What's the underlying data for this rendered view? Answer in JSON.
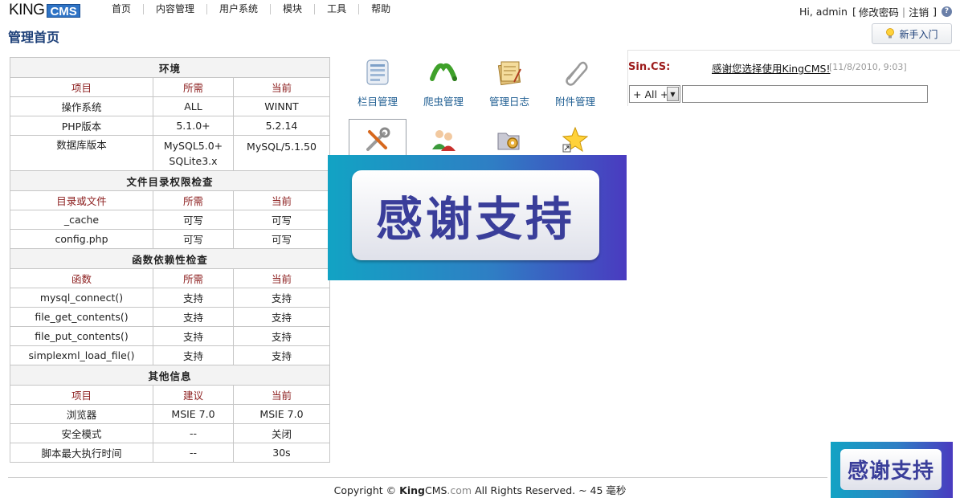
{
  "header": {
    "logo_king": "KING",
    "logo_cms": "CMS",
    "nav": [
      "首页",
      "内容管理",
      "用户系统",
      "模块",
      "工具",
      "帮助"
    ],
    "greeting": "Hi, admin",
    "bracket_open": "[",
    "change_password": "修改密码",
    "separator": "|",
    "logout": "注销",
    "bracket_close": "]"
  },
  "page_title": "管理首页",
  "guide_button": "新手入门",
  "env_table": {
    "sections": [
      {
        "title": "环境",
        "headers": [
          "项目",
          "所需",
          "当前"
        ],
        "rows": [
          [
            "操作系统",
            "ALL",
            "WINNT"
          ],
          [
            "PHP版本",
            "5.1.0+",
            "5.2.14"
          ],
          [
            "数据库版本",
            "MySQL5.0+ SQLite3.x",
            "MySQL/5.1.50"
          ]
        ]
      },
      {
        "title": "文件目录权限检查",
        "headers": [
          "目录或文件",
          "所需",
          "当前"
        ],
        "rows": [
          [
            "_cache",
            "可写",
            "可写"
          ],
          [
            "config.php",
            "可写",
            "可写"
          ]
        ]
      },
      {
        "title": "函数依赖性检查",
        "headers": [
          "函数",
          "所需",
          "当前"
        ],
        "rows": [
          [
            "mysql_connect()",
            "支持",
            "支持"
          ],
          [
            "file_get_contents()",
            "支持",
            "支持"
          ],
          [
            "file_put_contents()",
            "支持",
            "支持"
          ],
          [
            "simplexml_load_file()",
            "支持",
            "支持"
          ]
        ]
      },
      {
        "title": "其他信息",
        "headers": [
          "项目",
          "建议",
          "当前"
        ],
        "rows": [
          [
            "浏览器",
            "MSIE 7.0",
            "MSIE 7.0"
          ],
          [
            "安全模式",
            "--",
            "关闭"
          ],
          [
            "脚本最大执行时间",
            "--",
            "30s"
          ]
        ]
      }
    ]
  },
  "shortcuts": [
    {
      "label": "栏目管理",
      "icon": "column-manage-icon"
    },
    {
      "label": "爬虫管理",
      "icon": "crawler-icon"
    },
    {
      "label": "管理日志",
      "icon": "log-icon"
    },
    {
      "label": "附件管理",
      "icon": "attachment-icon"
    },
    {
      "label": "",
      "icon": "tools-icon"
    },
    {
      "label": "",
      "icon": "users-icon"
    },
    {
      "label": "",
      "icon": "folder-settings-icon"
    },
    {
      "label": "",
      "icon": "favorite-star-icon"
    }
  ],
  "banner_text": "感谢支持",
  "news": {
    "author": "Sin.CS:",
    "message": "感谢您选择使用KingCMS!",
    "date": "[11/8/2010, 9:03]",
    "filter_value": "+ All +"
  },
  "footer": {
    "prefix": "Copyright ©",
    "brand": "King",
    "brand_cms": "CMS",
    "domain": ".com",
    "suffix": "All Rights Reserved. ~ 45 毫秒"
  },
  "colors": {
    "accent": "#1c3f78",
    "link": "#1f5e92",
    "header_red": "#8b1c1c",
    "banner_start": "#12a3c4",
    "banner_end": "#4a3bc0"
  }
}
